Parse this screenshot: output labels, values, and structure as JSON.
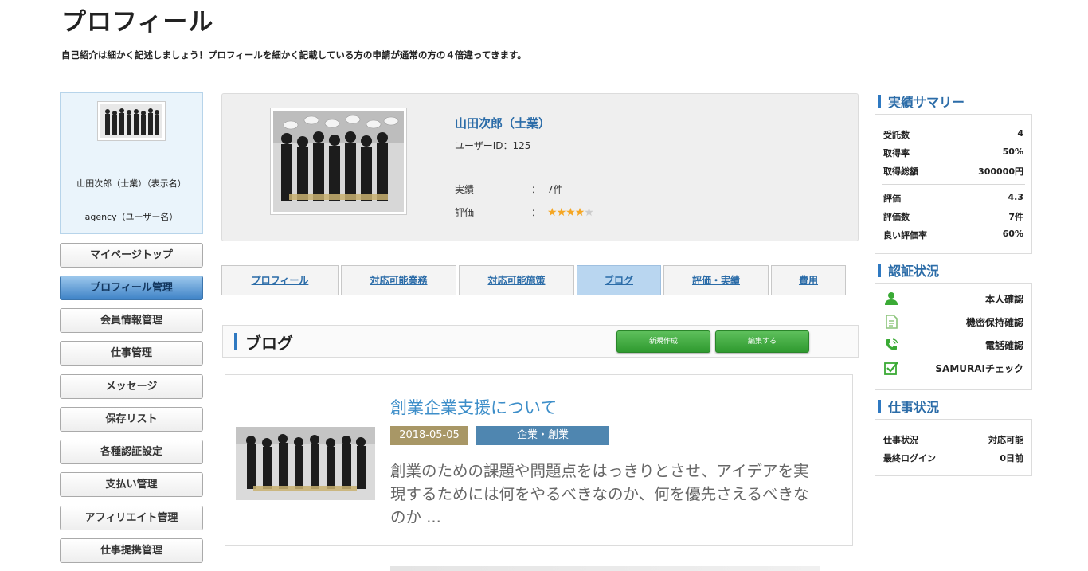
{
  "page": {
    "title": "プロフィール",
    "subtitle": "自己紹介は細かく記述しましょう！プロフィールを細かく記載している方の申請が通常の方の４倍違ってきます。"
  },
  "left_profile": {
    "display_name": "山田次郎（士業）（表示名）",
    "username": "agency（ユーザー名）"
  },
  "menu": [
    {
      "label": "マイページトップ",
      "active": false
    },
    {
      "label": "プロフィール管理",
      "active": true
    },
    {
      "label": "会員情報管理",
      "active": false
    },
    {
      "label": "仕事管理",
      "active": false
    },
    {
      "label": "メッセージ",
      "active": false
    },
    {
      "label": "保存リスト",
      "active": false
    },
    {
      "label": "各種認証設定",
      "active": false
    },
    {
      "label": "支払い管理",
      "active": false
    },
    {
      "label": "アフィリエイト管理",
      "active": false
    },
    {
      "label": "仕事提携管理",
      "active": false
    }
  ],
  "profile_card": {
    "name": "山田次郎（士業）",
    "user_id": "ユーザーID：125",
    "achievement_label": "実績",
    "achievement_value": "7件",
    "rating_label": "評価",
    "colon": "：",
    "rating_stars": 4,
    "rating_max": 5
  },
  "tabs": [
    {
      "label": "プロフィール",
      "active": false
    },
    {
      "label": "対応可能業務",
      "active": false
    },
    {
      "label": "対応可能施策",
      "active": false
    },
    {
      "label": "ブログ",
      "active": true
    },
    {
      "label": "評価・実績",
      "active": false
    },
    {
      "label": "費用",
      "active": false
    }
  ],
  "blog": {
    "heading": "ブログ",
    "new_button": "新規作成",
    "edit_button": "編集する",
    "post": {
      "title": "創業企業支援について",
      "date": "2018-05-05",
      "category": "企業・創業",
      "excerpt": "創業のための課題や問題点をはっきりとさせ、アイデアを実現するためには何をやるべきなのか、何を優先さえるべきなのか ..."
    }
  },
  "summary": {
    "heading": "実績サマリー",
    "items": [
      {
        "label": "受託数",
        "value": "4"
      },
      {
        "label": "取得率",
        "value": "50%"
      },
      {
        "label": "取得総額",
        "value": "300000円"
      },
      {
        "label": "評価",
        "value": "4.3"
      },
      {
        "label": "評価数",
        "value": "7件"
      },
      {
        "label": "良い評価率",
        "value": "60%"
      }
    ]
  },
  "certification": {
    "heading": "認証状況",
    "items": [
      {
        "icon": "person-icon",
        "label": "本人確認",
        "color": "#3aaa35"
      },
      {
        "icon": "document-icon",
        "label": "機密保持確認",
        "color": "#8bc47a"
      },
      {
        "icon": "phone-icon",
        "label": "電話確認",
        "color": "#3aaa35"
      },
      {
        "icon": "checkbox-icon",
        "label": "SAMURAIチェック",
        "color": "#3aaa35"
      }
    ]
  },
  "work_status": {
    "heading": "仕事状況",
    "items": [
      {
        "label": "仕事状況",
        "value": "対応可能"
      },
      {
        "label": "最終ログイン",
        "value": "0日前"
      }
    ]
  },
  "colors": {
    "accent_blue": "#2b6ca8",
    "green_button": "#3aa83a",
    "date_badge": "#a89766",
    "category_badge": "#4f86b0"
  }
}
